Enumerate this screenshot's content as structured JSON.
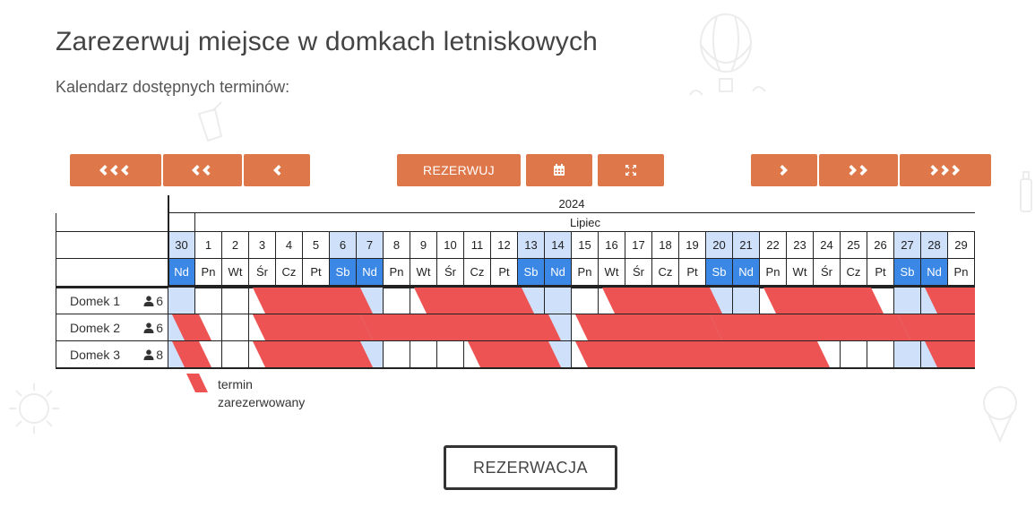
{
  "title": "Zarezerwuj miejsce w domkach letniskowych",
  "subtitle": "Kalendarz dostępnych terminów:",
  "nav": {
    "reserve_label": "REZERWUJ"
  },
  "calendar": {
    "year": "2024",
    "month": "Lipiec",
    "days": [
      {
        "n": "30",
        "d": "Nd",
        "we": true
      },
      {
        "n": "1",
        "d": "Pn",
        "we": false
      },
      {
        "n": "2",
        "d": "Wt",
        "we": false
      },
      {
        "n": "3",
        "d": "Śr",
        "we": false
      },
      {
        "n": "4",
        "d": "Cz",
        "we": false
      },
      {
        "n": "5",
        "d": "Pt",
        "we": false
      },
      {
        "n": "6",
        "d": "Sb",
        "we": true
      },
      {
        "n": "7",
        "d": "Nd",
        "we": true
      },
      {
        "n": "8",
        "d": "Pn",
        "we": false
      },
      {
        "n": "9",
        "d": "Wt",
        "we": false
      },
      {
        "n": "10",
        "d": "Śr",
        "we": false
      },
      {
        "n": "11",
        "d": "Cz",
        "we": false
      },
      {
        "n": "12",
        "d": "Pt",
        "we": false
      },
      {
        "n": "13",
        "d": "Sb",
        "we": true
      },
      {
        "n": "14",
        "d": "Nd",
        "we": true
      },
      {
        "n": "15",
        "d": "Pn",
        "we": false
      },
      {
        "n": "16",
        "d": "Wt",
        "we": false
      },
      {
        "n": "17",
        "d": "Śr",
        "we": false
      },
      {
        "n": "18",
        "d": "Cz",
        "we": false
      },
      {
        "n": "19",
        "d": "Pt",
        "we": false
      },
      {
        "n": "20",
        "d": "Sb",
        "we": true
      },
      {
        "n": "21",
        "d": "Nd",
        "we": true
      },
      {
        "n": "22",
        "d": "Pn",
        "we": false
      },
      {
        "n": "23",
        "d": "Wt",
        "we": false
      },
      {
        "n": "24",
        "d": "Śr",
        "we": false
      },
      {
        "n": "25",
        "d": "Cz",
        "we": false
      },
      {
        "n": "26",
        "d": "Pt",
        "we": false
      },
      {
        "n": "27",
        "d": "Sb",
        "we": true
      },
      {
        "n": "28",
        "d": "Nd",
        "we": true
      },
      {
        "n": "29",
        "d": "Pn",
        "we": false
      }
    ],
    "cabins": [
      {
        "name": "Domek 1",
        "capacity": "6",
        "booked": [
          [
            3,
            7
          ],
          [
            9,
            13
          ],
          [
            16,
            20
          ],
          [
            22,
            26
          ],
          [
            28,
            30
          ]
        ]
      },
      {
        "name": "Domek 2",
        "capacity": "6",
        "booked": [
          [
            0,
            1
          ],
          [
            3,
            7
          ],
          [
            7,
            14
          ],
          [
            15,
            20
          ],
          [
            20,
            27
          ],
          [
            27,
            30
          ]
        ]
      },
      {
        "name": "Domek 3",
        "capacity": "8",
        "booked": [
          [
            0,
            1
          ],
          [
            3,
            7
          ],
          [
            11,
            14
          ],
          [
            15,
            24
          ],
          [
            28,
            30
          ]
        ]
      }
    ]
  },
  "legend": {
    "line1": "termin",
    "line2": "zarezerwowany"
  },
  "footer": {
    "button_label": "REZERWACJA"
  },
  "colors": {
    "accent": "#de774a",
    "booked": "#ec5352",
    "weekend": "#3b87e6",
    "weekend_light": "#cfe0fa"
  }
}
